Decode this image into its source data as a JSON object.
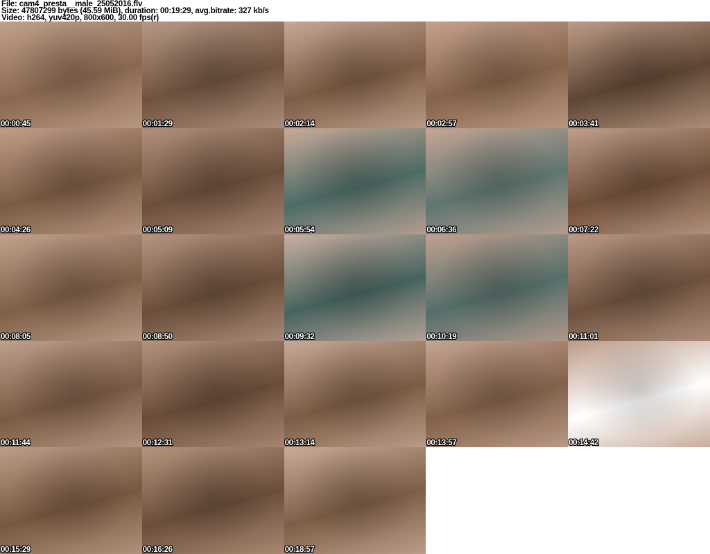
{
  "header": {
    "file_line": "File: cam4_presta__male_25052016.flv",
    "size_line": "Size: 47807299 bytes (45.59 MiB), duration: 00:19:29, avg.bitrate: 327 kb/s",
    "video_line": "Video: h264, yuv420p, 800x600, 30.00 fps(r)"
  },
  "colors": {
    "page_background": "#ffffff",
    "header_text": "#000000",
    "timestamp_text": "#ffffff",
    "timestamp_outline": "#000000"
  },
  "grid": {
    "columns": 5,
    "thumbnail_count": 23,
    "thumbnails": [
      {
        "time": "00:00:45",
        "colors": [
          "#c2a18c",
          "#8a6850"
        ]
      },
      {
        "time": "00:01:29",
        "colors": [
          "#b79a86",
          "#6f5340"
        ]
      },
      {
        "time": "00:02:14",
        "colors": [
          "#c7a896",
          "#7c5c44"
        ]
      },
      {
        "time": "00:02:57",
        "colors": [
          "#c4a28e",
          "#85634a"
        ]
      },
      {
        "time": "00:03:41",
        "colors": [
          "#bd9c88",
          "#5e4634"
        ]
      },
      {
        "time": "00:04:26",
        "colors": [
          "#c09e8a",
          "#7b5b44"
        ]
      },
      {
        "time": "00:05:09",
        "colors": [
          "#b2907c",
          "#6b4f3c"
        ]
      },
      {
        "time": "00:05:54",
        "colors": [
          "#c9aa98",
          "#4e6b66"
        ]
      },
      {
        "time": "00:06:36",
        "colors": [
          "#c6a694",
          "#5f7571"
        ]
      },
      {
        "time": "00:07:22",
        "colors": [
          "#bf9e8a",
          "#704f3a"
        ]
      },
      {
        "time": "00:08:05",
        "colors": [
          "#c3a28e",
          "#7e5f48"
        ]
      },
      {
        "time": "00:08:50",
        "colors": [
          "#b69682",
          "#6a4e3a"
        ]
      },
      {
        "time": "00:09:32",
        "colors": [
          "#cbb0a0",
          "#47635f"
        ]
      },
      {
        "time": "00:10:19",
        "colors": [
          "#c2a290",
          "#556e6a"
        ]
      },
      {
        "time": "00:11:01",
        "colors": [
          "#bb9a86",
          "#6d513e"
        ]
      },
      {
        "time": "00:11:44",
        "colors": [
          "#c0a08c",
          "#795a44"
        ]
      },
      {
        "time": "00:12:31",
        "colors": [
          "#b4927e",
          "#684c38"
        ]
      },
      {
        "time": "00:13:14",
        "colors": [
          "#c8a997",
          "#7b5c44"
        ]
      },
      {
        "time": "00:13:57",
        "colors": [
          "#c5a492",
          "#82614a"
        ]
      },
      {
        "time": "00:14:42",
        "colors": [
          "#bc9b87",
          "#60483600"
        ]
      },
      {
        "time": "00:15:29",
        "colors": [
          "#bf9e8a",
          "#77573f"
        ]
      },
      {
        "time": "00:16:26",
        "colors": [
          "#b6957f",
          "#6a4e3a"
        ]
      },
      {
        "time": "00:18:57",
        "colors": [
          "#c9ab99",
          "#7d5e46"
        ]
      }
    ]
  }
}
